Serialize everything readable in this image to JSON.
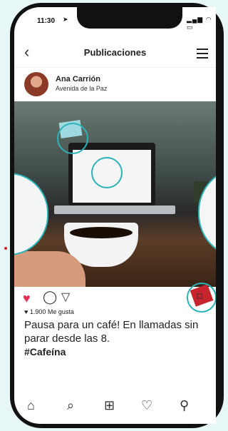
{
  "status_bar": {
    "time": "11:30",
    "location_icon": "location-arrow",
    "right_icons": "wifi signal battery"
  },
  "header": {
    "title": "Publicaciones",
    "back_icon": "chevron-left-icon",
    "menu_icon": "hamburger-icon"
  },
  "post": {
    "user": "Ana Carrión",
    "location": "Avenida de la Paz",
    "likes": "1.900 Me gusta",
    "caption": "Pausa para un café! En llamadas sin parar desde las 8.",
    "hashtag": "#Cafeína",
    "colors": {
      "accent": "#2bb3b8",
      "like": "#e53152"
    }
  },
  "tabbar": {
    "items": [
      "home-icon",
      "search-icon",
      "add-icon",
      "heart-icon",
      "profile-icon"
    ]
  }
}
